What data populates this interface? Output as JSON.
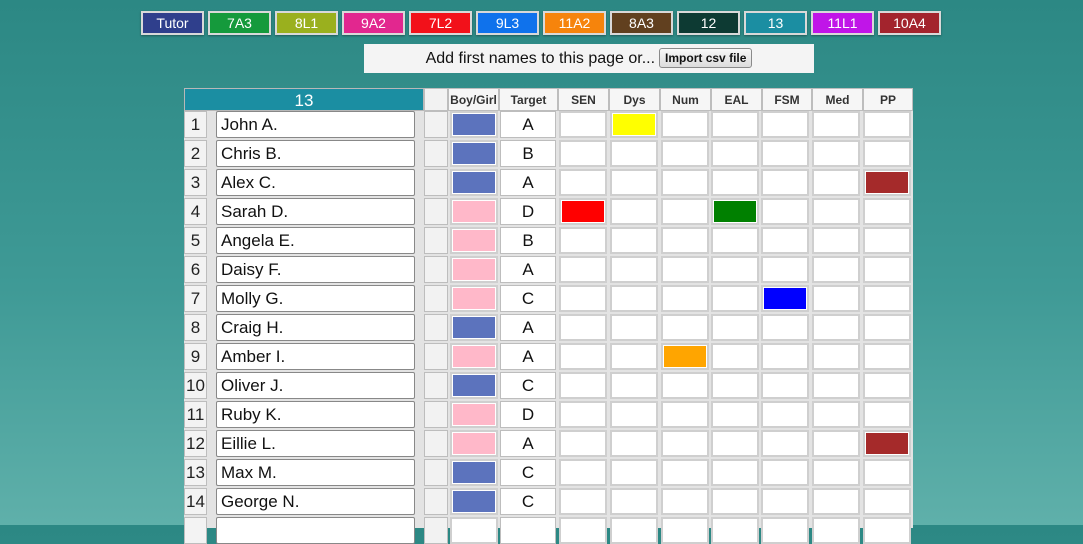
{
  "tabs": [
    {
      "label": "Tutor",
      "color": "#2f3f8c"
    },
    {
      "label": "7A3",
      "color": "#159a3c"
    },
    {
      "label": "8L1",
      "color": "#9ab01e"
    },
    {
      "label": "9A2",
      "color": "#e2278f"
    },
    {
      "label": "7L2",
      "color": "#f2111a"
    },
    {
      "label": "9L3",
      "color": "#0f72ec"
    },
    {
      "label": "11A2",
      "color": "#f6840c"
    },
    {
      "label": "8A3",
      "color": "#61401f"
    },
    {
      "label": "12",
      "color": "#0d3a33"
    },
    {
      "label": "13",
      "color": "#1b8ea2"
    },
    {
      "label": "11L1",
      "color": "#c015e8"
    },
    {
      "label": "10A4",
      "color": "#a3242d"
    }
  ],
  "add_bar": {
    "text": "Add first names to this page or...",
    "import_label": "Import csv file"
  },
  "class_title": "13",
  "columns": [
    "Boy/Girl",
    "Target",
    "SEN",
    "Dys",
    "Num",
    "EAL",
    "FSM",
    "Med",
    "PP"
  ],
  "gender_colors": {
    "boy": "#5c73bd",
    "girl": "#ffb8c9"
  },
  "flag_colors": {
    "SEN": "#ff0000",
    "Dys": "#ffff00",
    "Num": "#ffa500",
    "EAL": "#008000",
    "FSM": "#0000ff",
    "Med": "#8a2be2",
    "PP": "#a52a2a"
  },
  "students": [
    {
      "num": "1",
      "name": "John A.",
      "gender": "boy",
      "target": "A",
      "flags": [
        "Dys"
      ]
    },
    {
      "num": "2",
      "name": "Chris B.",
      "gender": "boy",
      "target": "B",
      "flags": []
    },
    {
      "num": "3",
      "name": "Alex C.",
      "gender": "boy",
      "target": "A",
      "flags": [
        "PP"
      ]
    },
    {
      "num": "4",
      "name": "Sarah D.",
      "gender": "girl",
      "target": "D",
      "flags": [
        "SEN",
        "EAL"
      ]
    },
    {
      "num": "5",
      "name": "Angela E.",
      "gender": "girl",
      "target": "B",
      "flags": []
    },
    {
      "num": "6",
      "name": "Daisy F.",
      "gender": "girl",
      "target": "A",
      "flags": []
    },
    {
      "num": "7",
      "name": "Molly G.",
      "gender": "girl",
      "target": "C",
      "flags": [
        "FSM"
      ]
    },
    {
      "num": "8",
      "name": "Craig H.",
      "gender": "boy",
      "target": "A",
      "flags": []
    },
    {
      "num": "9",
      "name": "Amber I.",
      "gender": "girl",
      "target": "A",
      "flags": [
        "Num"
      ]
    },
    {
      "num": "10",
      "name": "Oliver J.",
      "gender": "boy",
      "target": "C",
      "flags": []
    },
    {
      "num": "11",
      "name": "Ruby K.",
      "gender": "girl",
      "target": "D",
      "flags": []
    },
    {
      "num": "12",
      "name": "Eillie L.",
      "gender": "girl",
      "target": "A",
      "flags": [
        "PP"
      ]
    },
    {
      "num": "13",
      "name": "Max M.",
      "gender": "boy",
      "target": "C",
      "flags": []
    },
    {
      "num": "14",
      "name": "George N.",
      "gender": "boy",
      "target": "C",
      "flags": []
    },
    {
      "num": "",
      "name": "",
      "gender": "",
      "target": "",
      "flags": []
    }
  ]
}
